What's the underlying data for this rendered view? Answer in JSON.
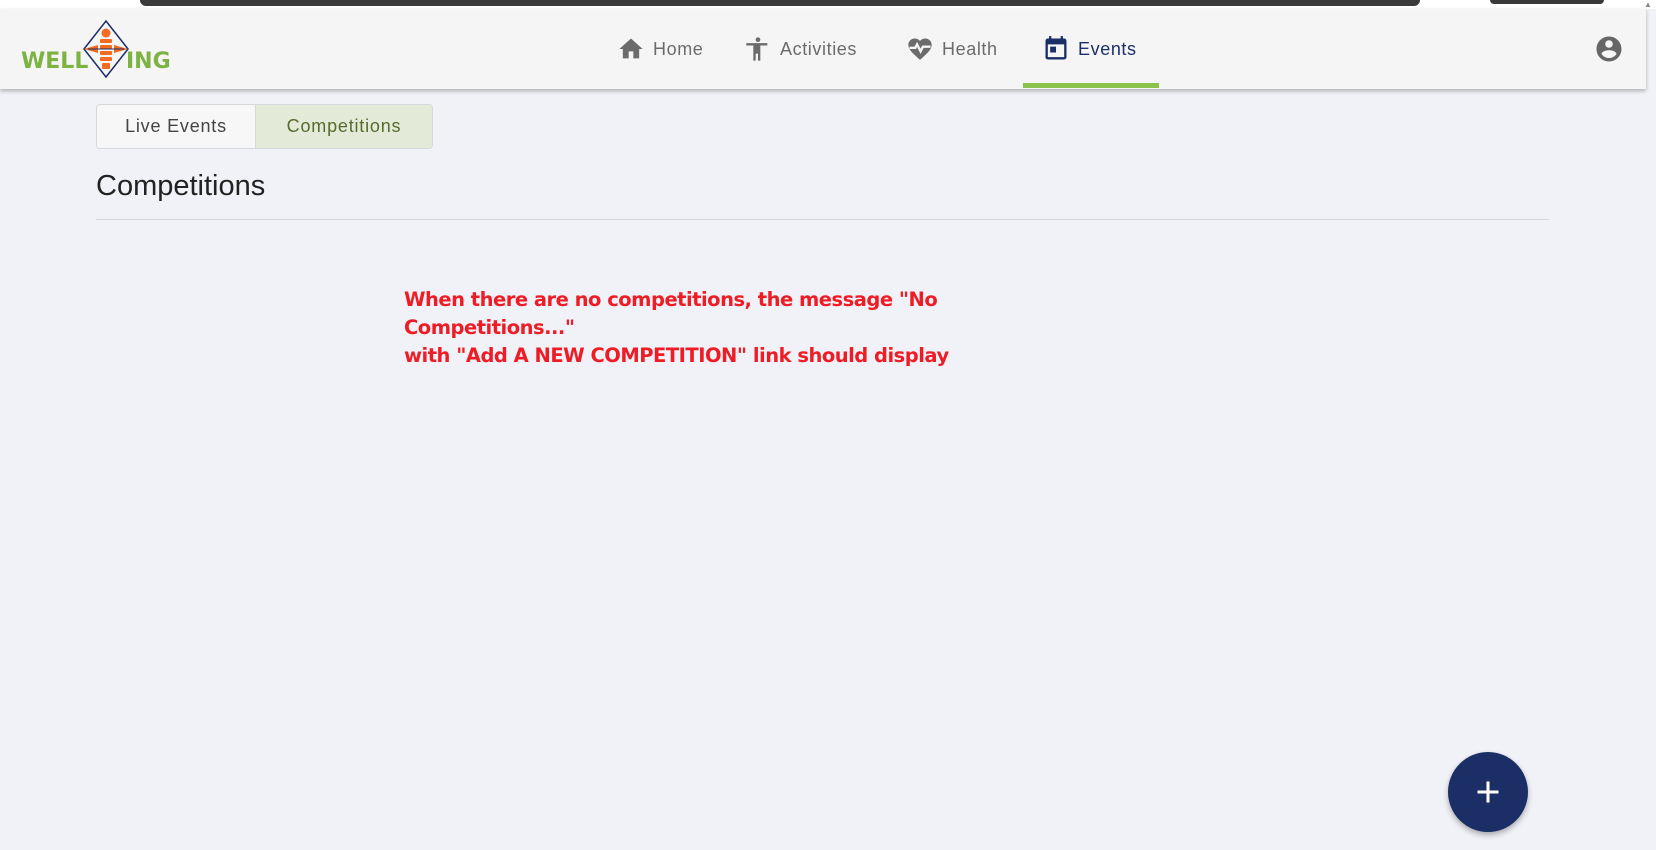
{
  "brand": {
    "logo_left": "WELL",
    "logo_right": "ING",
    "logo_green": "#7cb342",
    "logo_orange": "#f26b21",
    "logo_blue": "#1c2e66"
  },
  "nav": {
    "items": [
      {
        "label": "Home",
        "icon": "home-icon"
      },
      {
        "label": "Activities",
        "icon": "person-stretch-icon"
      },
      {
        "label": "Health",
        "icon": "heart-pulse-icon"
      },
      {
        "label": "Events",
        "icon": "calendar-icon"
      }
    ],
    "active": "Events",
    "active_color": "#1c2e66",
    "underline_color": "#8bc34a",
    "account_icon": "account-circle-icon"
  },
  "tabs": {
    "items": [
      {
        "label": "Live Events",
        "selected": false
      },
      {
        "label": "Competitions",
        "selected": true
      }
    ]
  },
  "page": {
    "title": "Competitions"
  },
  "annotation": {
    "line1": "When there are no competitions, the message \"No Competitions...\"",
    "line2": "with \"Add A NEW COMPETITION\" link should display",
    "color": "#ee1c25"
  },
  "fab": {
    "icon": "plus-icon",
    "color": "#1c2e66"
  }
}
